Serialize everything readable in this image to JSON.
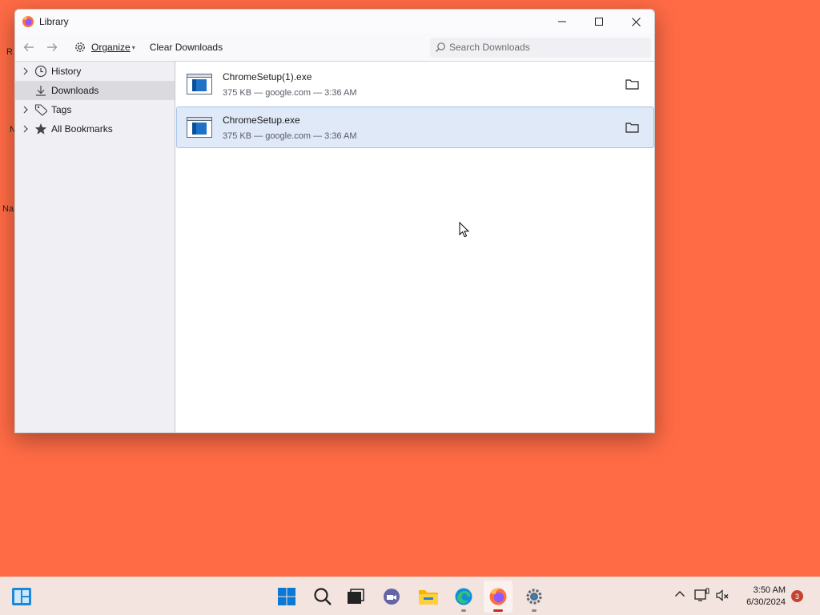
{
  "desktop": {
    "peek_labels": [
      "R",
      "N",
      "Na"
    ]
  },
  "window": {
    "title": "Library"
  },
  "toolbar": {
    "organize_label": "Organize",
    "clear_label": "Clear Downloads",
    "search_placeholder": "Search Downloads"
  },
  "sidebar": {
    "items": [
      {
        "label": "History",
        "icon": "clock-icon",
        "expandable": true
      },
      {
        "label": "Downloads",
        "icon": "download-icon",
        "expandable": false,
        "selected": true
      },
      {
        "label": "Tags",
        "icon": "tag-icon",
        "expandable": true
      },
      {
        "label": "All Bookmarks",
        "icon": "star-icon",
        "expandable": true
      }
    ]
  },
  "downloads": [
    {
      "name": "ChromeSetup(1).exe",
      "meta": "375 KB — google.com — 3:36 AM",
      "selected": false
    },
    {
      "name": "ChromeSetup.exe",
      "meta": "375 KB — google.com — 3:36 AM",
      "selected": true
    }
  ],
  "taskbar": {
    "apps": [
      "start-icon",
      "search-icon",
      "task-view-icon",
      "teams-chat-icon",
      "file-explorer-icon",
      "edge-icon",
      "firefox-icon",
      "settings-icon"
    ],
    "time": "3:50 AM",
    "date": "6/30/2024",
    "notification_count": "3"
  },
  "colors": {
    "desktop": "#ff6b45",
    "selection": "#dfe9f8",
    "accent": "#0067c0"
  }
}
